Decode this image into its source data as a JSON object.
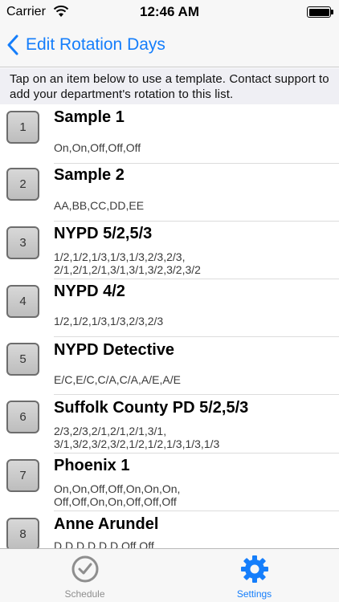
{
  "status_bar": {
    "carrier": "Carrier",
    "time": "12:46 AM",
    "battery_level": 1.0
  },
  "nav": {
    "back_label": "Edit Rotation Days",
    "back_icon": "chevron-left-icon"
  },
  "instructions": "Tap on an item below to use a template.  Contact support to add your department's rotation to this list.",
  "templates": [
    {
      "number": "1",
      "title": "Sample 1",
      "detail": "On,On,Off,Off,Off"
    },
    {
      "number": "2",
      "title": "Sample 2",
      "detail": "AA,BB,CC,DD,EE"
    },
    {
      "number": "3",
      "title": "NYPD 5/2,5/3",
      "detail": "1/2,1/2,1/3,1/3,1/3,2/3,2/3,\n2/1,2/1,2/1,3/1,3/1,3/2,3/2,3/2"
    },
    {
      "number": "4",
      "title": "NYPD 4/2",
      "detail": "1/2,1/2,1/3,1/3,2/3,2/3"
    },
    {
      "number": "5",
      "title": "NYPD Detective",
      "detail": "E/C,E/C,C/A,C/A,A/E,A/E"
    },
    {
      "number": "6",
      "title": "Suffolk County PD 5/2,5/3",
      "detail": "2/3,2/3,2/1,2/1,2/1,3/1,\n3/1,3/2,3/2,3/2,1/2,1/2,1/3,1/3,1/3"
    },
    {
      "number": "7",
      "title": "Phoenix 1",
      "detail": "On,On,Off,Off,On,On,On,\nOff,Off,On,On,Off,Off,Off"
    },
    {
      "number": "8",
      "title": "Anne Arundel",
      "detail": "D,D,D,D,D,D,Off,Off"
    }
  ],
  "tab_bar": {
    "schedule_label": "Schedule",
    "settings_label": "Settings",
    "schedule_icon": "clock-check-icon",
    "settings_icon": "gear-icon",
    "active_color": "#157efb",
    "inactive_color": "#8e8e8e"
  }
}
